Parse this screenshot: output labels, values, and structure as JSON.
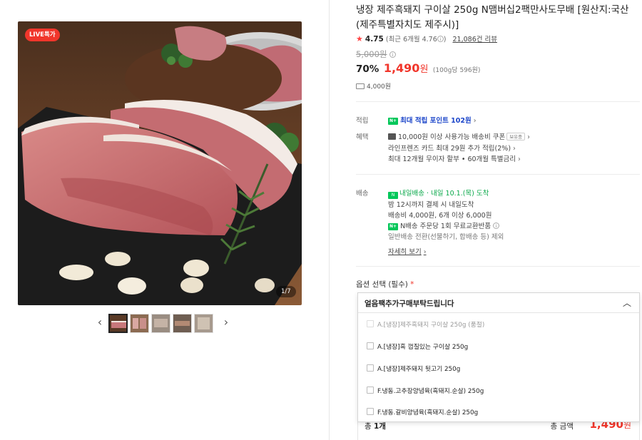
{
  "image": {
    "live_badge": "LIVE특가",
    "counter": "1/7"
  },
  "thumbnails": [
    "thumb-1",
    "thumb-2",
    "thumb-3",
    "thumb-4",
    "thumb-5"
  ],
  "product": {
    "title": "냉장 제주흑돼지 구이살 250g N맴버십2팩만사도무배 [원산지:국산(제주특별자치도 제주시)]",
    "rating": "4.75",
    "rating_recent": "(최근 6개월 4.76",
    "rating_recent_close": ")",
    "reviews": "21,086건 리뷰",
    "original_price": "5,000원",
    "discount": "70%",
    "price": "1,490",
    "price_unit": "원",
    "unit_price": "(100g당 596원)",
    "shipping": "4,000원"
  },
  "benefits": {
    "points_label": "적립",
    "points_text": "최대 적립 포인트 102원",
    "benefit_label": "혜택",
    "coupon_text": "10,000원 이상 사용가능 배송비 쿠폰",
    "coupon_badge": "보유중",
    "card_text": "라인프렌즈 카드 최대 29원 추가 적립(2%)",
    "installment_text": "최대 12개월 무이자 할부 • 60개월 특별금리"
  },
  "delivery": {
    "label": "배송",
    "tomorrow": "내일배송",
    "arrival": "· 내일 10.1.(목) 도착",
    "cutoff": "밤 12시까지 결제 시 내일도착",
    "fee": "배송비 4,000원, 6개 이상 6,000원",
    "npay_text": "N배송 주문당 1회 무료교환반품",
    "exclude": "일반배송 전환(선물하기, 합배송 등) 제외",
    "detail_link": "자세히 보기"
  },
  "option": {
    "label": "옵션 선택 (필수)",
    "required_mark": "*",
    "header": "얼음팩추가구매부탁드립니다",
    "items": [
      {
        "text": "A.[냉장]제주흑돼지 구이살 250g (품절)",
        "disabled": true
      },
      {
        "text": "A.[냉장]흑 껍질있는 구이살 250g",
        "disabled": false
      },
      {
        "text": "A.[냉장]제주돼지 뒷고기 250g",
        "disabled": false
      },
      {
        "text": "F.냉동.고추장양념육(흑돼지.순살) 250g",
        "disabled": false
      },
      {
        "text": "F.냉동.갈비양념육(흑돼지.순살) 250g",
        "disabled": false
      }
    ]
  },
  "total": {
    "qty_label": "총 ",
    "qty": "1개",
    "amount_label": "총 금액",
    "amount": "1,490",
    "amount_unit": "원"
  }
}
